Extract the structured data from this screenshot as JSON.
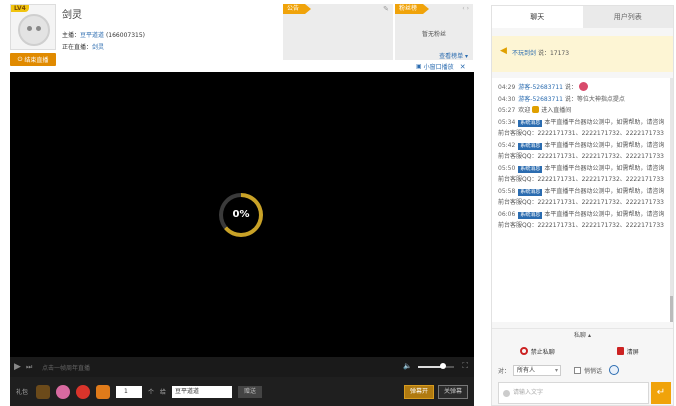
{
  "header": {
    "level_badge": "LV4",
    "title": "剑灵",
    "host_label": "主播：",
    "host_name": "豆平道道",
    "host_id": "(166007315)",
    "live_label": "正在直播：",
    "live_game": "剑灵",
    "report_button": "结束直播",
    "panel1_tag": "公告",
    "panel2_tag": "粉丝榜",
    "no_fans_text": "暂无粉丝",
    "rank_link": "查看榜单 ▾",
    "mini_play": "小窗口播放"
  },
  "video": {
    "loading_percent": "0%",
    "loading_fraction": 0.64,
    "control_hint": "点击一帧周年直播",
    "volume_fraction": 0.7
  },
  "gift_bar": {
    "label": "礼包",
    "quantity": "1",
    "unit": "个",
    "to_label": "给",
    "recipient": "豆平道道",
    "send_label": "赠送",
    "btn_barrage": "弹幕开",
    "btn_clear": "关弹幕"
  },
  "chat": {
    "tabs": [
      "聊天",
      "用户列表"
    ],
    "notice_user": "不玩到剑",
    "notice_text": "说：17173",
    "messages": [
      {
        "time": "04:29",
        "user": "游客-52683711",
        "text": " 说：",
        "gift": true
      },
      {
        "time": "04:30",
        "user": "游客-52683711",
        "text": " 说：等位大神指点提点"
      },
      {
        "time": "05:27",
        "user": "欢迎",
        "text": "进入直播间",
        "bell": true
      },
      {
        "time": "05:34",
        "sys": "系统消息",
        "text": "本平直播平台器动公测中，如需帮助，请咨询前台客服QQ：2222171731、2222171732、2222171733"
      },
      {
        "time": "05:42",
        "sys": "系统消息",
        "text": "本平直播平台器动公测中，如需帮助，请咨询前台客服QQ：2222171731、2222171732、2222171733"
      },
      {
        "time": "05:50",
        "sys": "系统消息",
        "text": "本平直播平台器动公测中，如需帮助，请咨询前台客服QQ：2222171731、2222171732、2222171733"
      },
      {
        "time": "05:58",
        "sys": "系统消息",
        "text": "本平直播平台器动公测中，如需帮助，请咨询前台客服QQ：2222171731、2222171732、2222171733"
      },
      {
        "time": "06:06",
        "sys": "系统消息",
        "text": "本平直播平台器动公测中，如需帮助，请咨询前台客服QQ：2222171731、2222171732、2222171733"
      }
    ],
    "area_toggle": "私聊 ▴",
    "ban_label": "禁止私聊",
    "clear_label": "清屏",
    "to_label": "对：",
    "to_value": "所有人",
    "private_label": "悄悄话",
    "input_placeholder": "请输入文字",
    "send_symbol": "↵"
  },
  "colors": {
    "accent": "#f0a30a",
    "link": "#2b6cb0",
    "danger": "#cc2222"
  }
}
